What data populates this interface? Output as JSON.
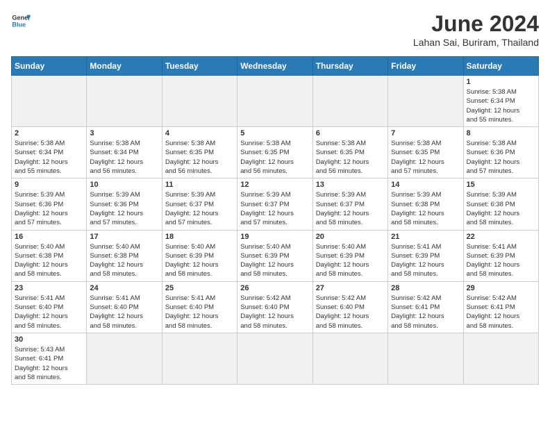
{
  "header": {
    "logo_general": "General",
    "logo_blue": "Blue",
    "month_year": "June 2024",
    "location": "Lahan Sai, Buriram, Thailand"
  },
  "days_of_week": [
    "Sunday",
    "Monday",
    "Tuesday",
    "Wednesday",
    "Thursday",
    "Friday",
    "Saturday"
  ],
  "weeks": [
    [
      {
        "day": "",
        "info": ""
      },
      {
        "day": "",
        "info": ""
      },
      {
        "day": "",
        "info": ""
      },
      {
        "day": "",
        "info": ""
      },
      {
        "day": "",
        "info": ""
      },
      {
        "day": "",
        "info": ""
      },
      {
        "day": "1",
        "info": "Sunrise: 5:38 AM\nSunset: 6:34 PM\nDaylight: 12 hours\nand 55 minutes."
      }
    ],
    [
      {
        "day": "2",
        "info": "Sunrise: 5:38 AM\nSunset: 6:34 PM\nDaylight: 12 hours\nand 55 minutes."
      },
      {
        "day": "3",
        "info": "Sunrise: 5:38 AM\nSunset: 6:34 PM\nDaylight: 12 hours\nand 56 minutes."
      },
      {
        "day": "4",
        "info": "Sunrise: 5:38 AM\nSunset: 6:35 PM\nDaylight: 12 hours\nand 56 minutes."
      },
      {
        "day": "5",
        "info": "Sunrise: 5:38 AM\nSunset: 6:35 PM\nDaylight: 12 hours\nand 56 minutes."
      },
      {
        "day": "6",
        "info": "Sunrise: 5:38 AM\nSunset: 6:35 PM\nDaylight: 12 hours\nand 56 minutes."
      },
      {
        "day": "7",
        "info": "Sunrise: 5:38 AM\nSunset: 6:35 PM\nDaylight: 12 hours\nand 57 minutes."
      },
      {
        "day": "8",
        "info": "Sunrise: 5:38 AM\nSunset: 6:36 PM\nDaylight: 12 hours\nand 57 minutes."
      }
    ],
    [
      {
        "day": "9",
        "info": "Sunrise: 5:39 AM\nSunset: 6:36 PM\nDaylight: 12 hours\nand 57 minutes."
      },
      {
        "day": "10",
        "info": "Sunrise: 5:39 AM\nSunset: 6:36 PM\nDaylight: 12 hours\nand 57 minutes."
      },
      {
        "day": "11",
        "info": "Sunrise: 5:39 AM\nSunset: 6:37 PM\nDaylight: 12 hours\nand 57 minutes."
      },
      {
        "day": "12",
        "info": "Sunrise: 5:39 AM\nSunset: 6:37 PM\nDaylight: 12 hours\nand 57 minutes."
      },
      {
        "day": "13",
        "info": "Sunrise: 5:39 AM\nSunset: 6:37 PM\nDaylight: 12 hours\nand 58 minutes."
      },
      {
        "day": "14",
        "info": "Sunrise: 5:39 AM\nSunset: 6:38 PM\nDaylight: 12 hours\nand 58 minutes."
      },
      {
        "day": "15",
        "info": "Sunrise: 5:39 AM\nSunset: 6:38 PM\nDaylight: 12 hours\nand 58 minutes."
      }
    ],
    [
      {
        "day": "16",
        "info": "Sunrise: 5:40 AM\nSunset: 6:38 PM\nDaylight: 12 hours\nand 58 minutes."
      },
      {
        "day": "17",
        "info": "Sunrise: 5:40 AM\nSunset: 6:38 PM\nDaylight: 12 hours\nand 58 minutes."
      },
      {
        "day": "18",
        "info": "Sunrise: 5:40 AM\nSunset: 6:39 PM\nDaylight: 12 hours\nand 58 minutes."
      },
      {
        "day": "19",
        "info": "Sunrise: 5:40 AM\nSunset: 6:39 PM\nDaylight: 12 hours\nand 58 minutes."
      },
      {
        "day": "20",
        "info": "Sunrise: 5:40 AM\nSunset: 6:39 PM\nDaylight: 12 hours\nand 58 minutes."
      },
      {
        "day": "21",
        "info": "Sunrise: 5:41 AM\nSunset: 6:39 PM\nDaylight: 12 hours\nand 58 minutes."
      },
      {
        "day": "22",
        "info": "Sunrise: 5:41 AM\nSunset: 6:39 PM\nDaylight: 12 hours\nand 58 minutes."
      }
    ],
    [
      {
        "day": "23",
        "info": "Sunrise: 5:41 AM\nSunset: 6:40 PM\nDaylight: 12 hours\nand 58 minutes."
      },
      {
        "day": "24",
        "info": "Sunrise: 5:41 AM\nSunset: 6:40 PM\nDaylight: 12 hours\nand 58 minutes."
      },
      {
        "day": "25",
        "info": "Sunrise: 5:41 AM\nSunset: 6:40 PM\nDaylight: 12 hours\nand 58 minutes."
      },
      {
        "day": "26",
        "info": "Sunrise: 5:42 AM\nSunset: 6:40 PM\nDaylight: 12 hours\nand 58 minutes."
      },
      {
        "day": "27",
        "info": "Sunrise: 5:42 AM\nSunset: 6:40 PM\nDaylight: 12 hours\nand 58 minutes."
      },
      {
        "day": "28",
        "info": "Sunrise: 5:42 AM\nSunset: 6:41 PM\nDaylight: 12 hours\nand 58 minutes."
      },
      {
        "day": "29",
        "info": "Sunrise: 5:42 AM\nSunset: 6:41 PM\nDaylight: 12 hours\nand 58 minutes."
      }
    ],
    [
      {
        "day": "30",
        "info": "Sunrise: 5:43 AM\nSunset: 6:41 PM\nDaylight: 12 hours\nand 58 minutes."
      },
      {
        "day": "",
        "info": ""
      },
      {
        "day": "",
        "info": ""
      },
      {
        "day": "",
        "info": ""
      },
      {
        "day": "",
        "info": ""
      },
      {
        "day": "",
        "info": ""
      },
      {
        "day": "",
        "info": ""
      }
    ]
  ]
}
